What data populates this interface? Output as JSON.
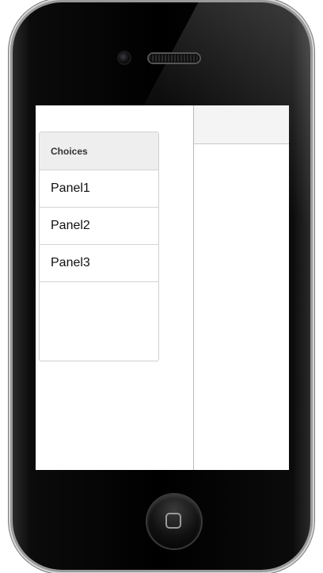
{
  "device": {
    "frame_color": "#000000",
    "bezel_color": "#9a9a9a"
  },
  "screen": {
    "background": "#ffffff"
  },
  "choices": {
    "header": "Choices",
    "items": [
      {
        "label": "Panel1"
      },
      {
        "label": "Panel2"
      },
      {
        "label": "Panel3"
      }
    ]
  }
}
